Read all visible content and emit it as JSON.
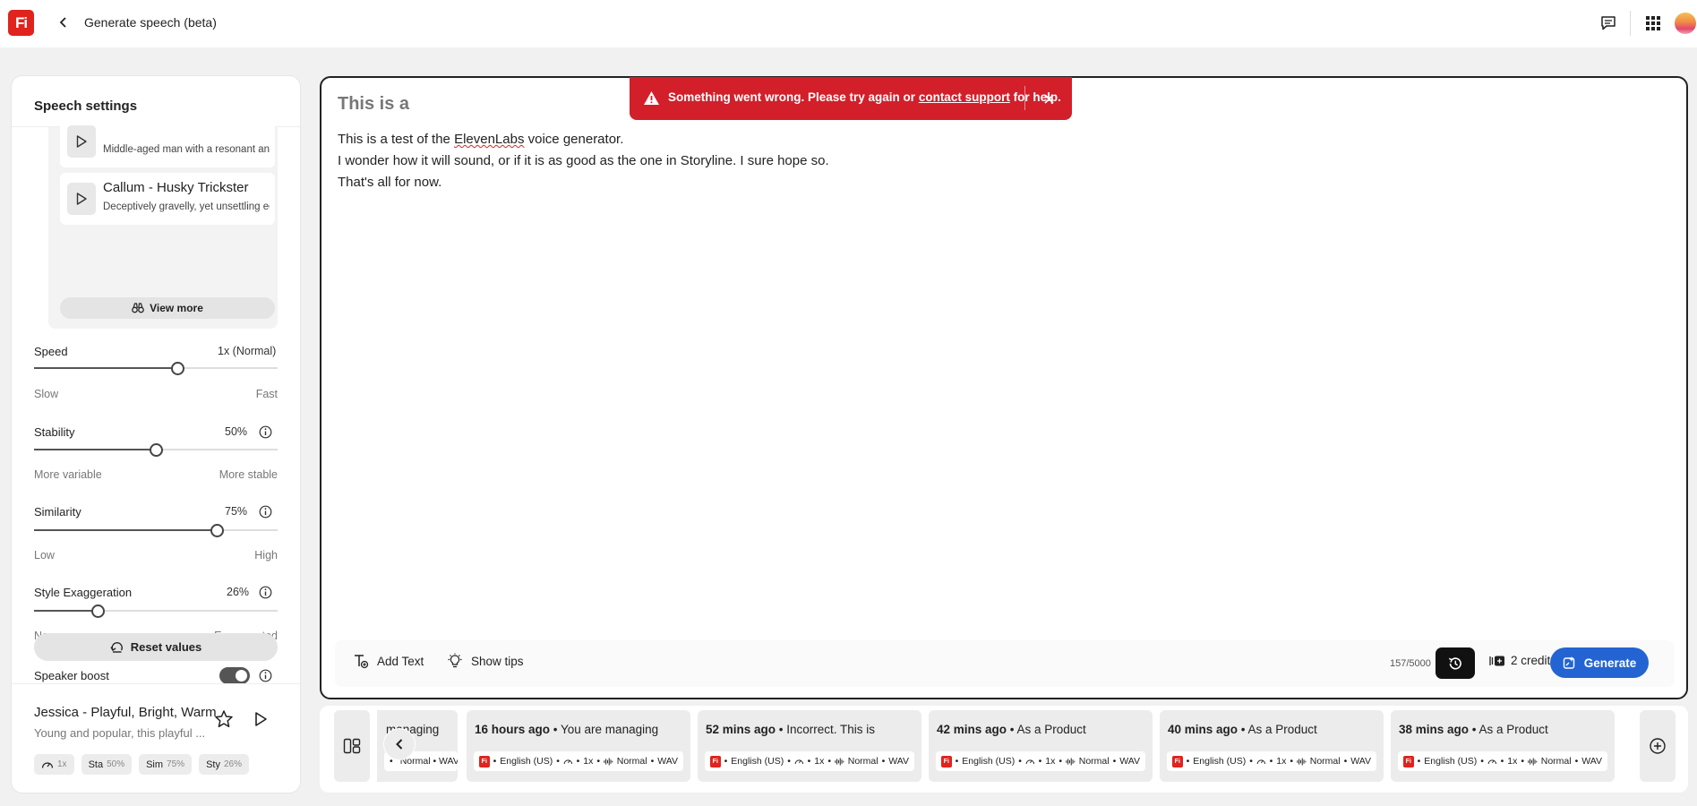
{
  "app": {
    "logo_text": "Fi",
    "title": "Generate speech (beta)",
    "brand_color": "#e0231d",
    "accent_color": "#2364d2"
  },
  "panel": {
    "title": "Speech settings",
    "voices": [
      {
        "name": "",
        "desc": "Middle-aged man with a resonant anc"
      },
      {
        "name": "Callum - Husky Trickster",
        "desc": "Deceptively gravelly, yet unsettling ed"
      }
    ],
    "view_more": "View more",
    "speed": {
      "label": "Speed",
      "value": "1x (Normal)",
      "min_label": "Slow",
      "max_label": "Fast",
      "level": 0.59
    },
    "stability": {
      "label": "Stability",
      "value": "50%",
      "min_label": "More variable",
      "max_label": "More stable",
      "level": 0.5
    },
    "similarity": {
      "label": "Similarity",
      "value": "75%",
      "min_label": "Low",
      "max_label": "High",
      "level": 0.75
    },
    "style": {
      "label": "Style Exaggeration",
      "value": "26%",
      "min_label": "None",
      "max_label": "Exaggerated",
      "level": 0.26
    },
    "speaker_boost": {
      "label": "Speaker boost",
      "on": true
    },
    "reset": "Reset values",
    "selected_voice": {
      "name": "Jessica - Playful, Bright, Warm",
      "desc": "Young and popular, this playful ..."
    },
    "chips": [
      {
        "label": "1x",
        "pct": ""
      },
      {
        "label": "Sta",
        "pct": "50%"
      },
      {
        "label": "Sim",
        "pct": "75%"
      },
      {
        "label": "Sty",
        "pct": "26%"
      }
    ]
  },
  "editor": {
    "doc_title": "This is a",
    "lines": {
      "l1_pre": "This is a test of the ",
      "l1_spell": "ElevenLabs",
      "l1_post": " voice generator.",
      "l2": "I wonder how it will sound, or if it is as good as the one in Storyline. I sure hope so.",
      "l3": "That's all for now."
    },
    "add_text": "Add Text",
    "show_tips": "Show tips",
    "char_count": "157/5000",
    "credits": "2 credits",
    "generate": "Generate"
  },
  "toast": {
    "pre": "Something went wrong. Please try again or ",
    "link": "contact support",
    "post": " for help."
  },
  "history": [
    {
      "time": "",
      "text": "managing",
      "meta": "Normal • WAV",
      "partial": true
    },
    {
      "time": "16 hours ago",
      "text": "You are managing",
      "lang": "English (US)",
      "speed": "1x",
      "quality": "Normal",
      "format": "WAV"
    },
    {
      "time": "52 mins ago",
      "text": "Incorrect. This is",
      "lang": "English (US)",
      "speed": "1x",
      "quality": "Normal",
      "format": "WAV"
    },
    {
      "time": "42 mins ago",
      "text": "As a Product",
      "lang": "English (US)",
      "speed": "1x",
      "quality": "Normal",
      "format": "WAV"
    },
    {
      "time": "40 mins ago",
      "text": "As a Product",
      "lang": "English (US)",
      "speed": "1x",
      "quality": "Normal",
      "format": "WAV"
    },
    {
      "time": "38 mins ago",
      "text": "As a Product",
      "lang": "English (US)",
      "speed": "1x",
      "quality": "Normal",
      "format": "WAV"
    }
  ]
}
